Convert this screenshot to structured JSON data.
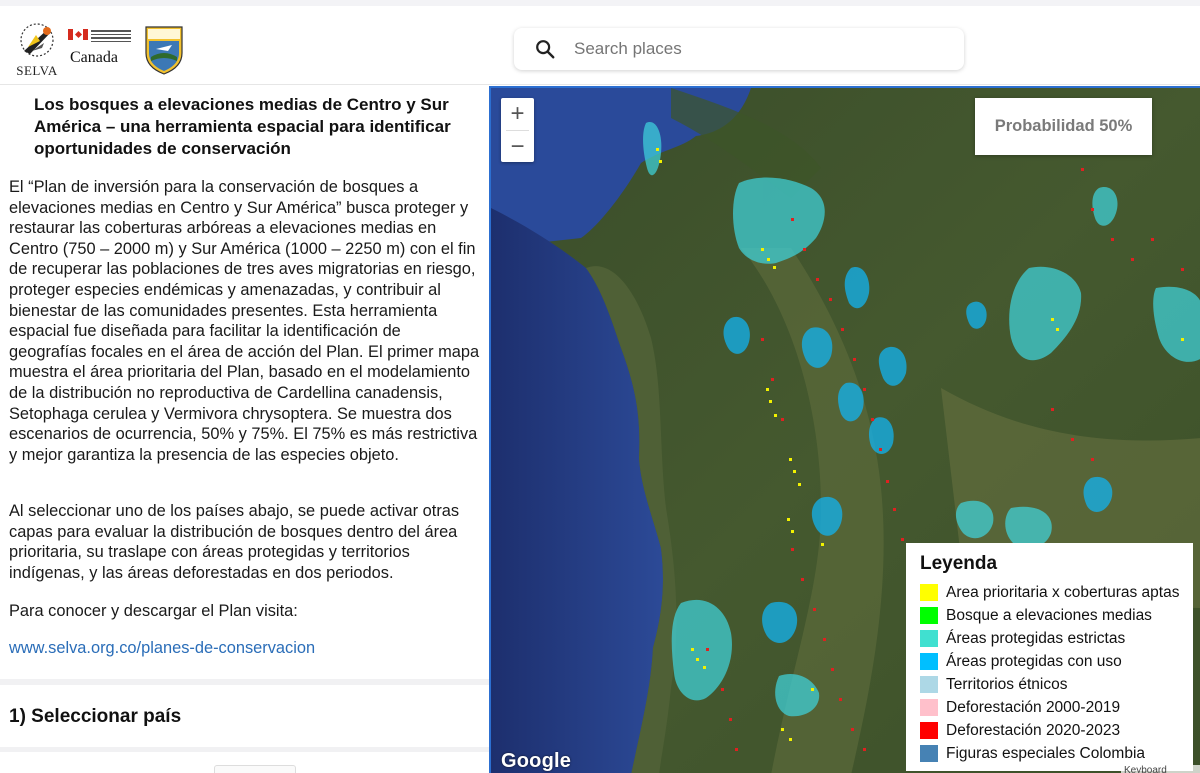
{
  "header": {
    "logos": {
      "selva": "SELVA",
      "canada": "Canada",
      "fws": "U.S. Fish & Wildlife Service"
    },
    "search": {
      "placeholder": "Search places",
      "value": ""
    }
  },
  "panel": {
    "title": "Los bosques a elevaciones medias de Centro y Sur América – una herramienta espacial para identificar oportunidades de conservación",
    "paragraph1": "El “Plan de inversión para la conservación de bosques a elevaciones medias en Centro y Sur América” busca proteger y restaurar las coberturas arbóreas a elevaciones medias en Centro (750 – 2000 m) y Sur América (1000 – 2250 m) con el fin de recuperar las poblaciones de tres aves migratorias en riesgo, proteger especies endémicas y amenazadas, y contribuir al bienestar de las comunidades presentes. Esta herramienta espacial fue diseñada para facilitar la identificación de geografías focales en el área de acción del Plan. El primer mapa muestra el área prioritaria del Plan, basado en el modelamiento de la distribución no reproductiva de Cardellina canadensis, Setophaga cerulea y Vermivora chrysoptera. Se muestra dos escenarios de ocurrencia, 50% y 75%. El 75% es más restrictiva y mejor garantiza la presencia de las especies objeto.",
    "paragraph2": "Al seleccionar uno de los países abajo, se puede activar otras capas para evaluar la distribución de bosques dentro del área prioritaria, su traslape con áreas protegidas y territorios indígenas, y las áreas deforestadas en dos periodos.",
    "paragraph3": "Para conocer y descargar el Plan visita:",
    "link": "www.selva.org.co/planes-de-conservacion",
    "section1": "1) Seleccionar país"
  },
  "map": {
    "zoom_in": "+",
    "zoom_out": "−",
    "probability_button": "Probabilidad 50%",
    "attribution": "Google",
    "keyboard": "Keyboard shortcuts",
    "legend": {
      "title": "Leyenda",
      "items": [
        {
          "label": "Area prioritaria x coberturas aptas",
          "color": "#ffff00"
        },
        {
          "label": "Bosque a elevaciones medias",
          "color": "#00ff00"
        },
        {
          "label": "Áreas protegidas estrictas",
          "color": "#40e0d0"
        },
        {
          "label": "Áreas protegidas con uso",
          "color": "#00bfff"
        },
        {
          "label": "Territorios étnicos",
          "color": "#add8e6"
        },
        {
          "label": "Deforestación 2000-2019",
          "color": "#ffc0cb"
        },
        {
          "label": "Deforestación 2020-2023",
          "color": "#ff0000"
        },
        {
          "label": "Figuras especiales Colombia",
          "color": "#4682b4"
        }
      ]
    }
  }
}
